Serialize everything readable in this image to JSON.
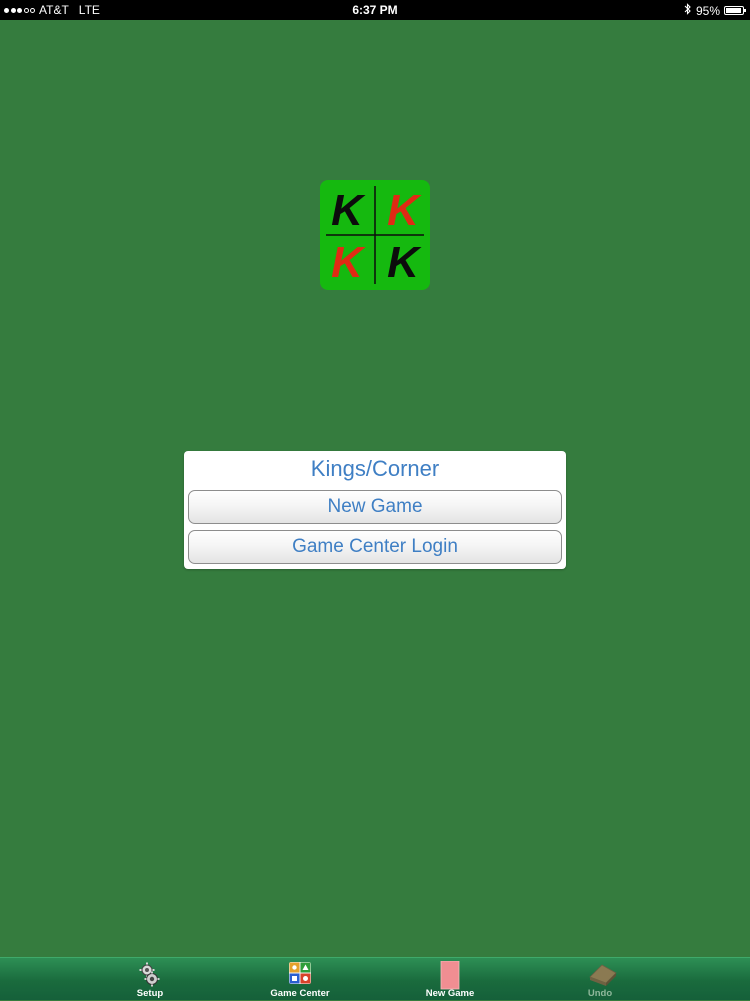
{
  "status_bar": {
    "carrier": "AT&T",
    "network": "LTE",
    "time": "6:37 PM",
    "battery_percent": "95%",
    "battery_level": 0.95,
    "signal_bars_filled": 3,
    "signal_bars_total": 5,
    "icons": [
      "signal-dots-icon",
      "bluetooth-icon",
      "battery-icon"
    ]
  },
  "app_icon": {
    "letters": [
      "K",
      "K",
      "K",
      "K"
    ],
    "colors": {
      "background": "#15b90f",
      "black_letter": "#0c0c0c",
      "red_letter": "#e12a14"
    }
  },
  "dialog": {
    "title": "Kings/Corner",
    "buttons": [
      {
        "label": "New Game"
      },
      {
        "label": "Game Center Login"
      }
    ],
    "accent_color": "#3f7fc4"
  },
  "tab_bar": {
    "items": [
      {
        "label": "Setup",
        "icon": "gear-icon",
        "enabled": true
      },
      {
        "label": "Game Center",
        "icon": "game-center-icon",
        "enabled": true
      },
      {
        "label": "New Game",
        "icon": "card-icon",
        "enabled": true
      },
      {
        "label": "Undo",
        "icon": "undo-card-icon",
        "enabled": false
      }
    ]
  },
  "colors": {
    "table_green": "#357c3e",
    "status_bar": "#000000"
  }
}
